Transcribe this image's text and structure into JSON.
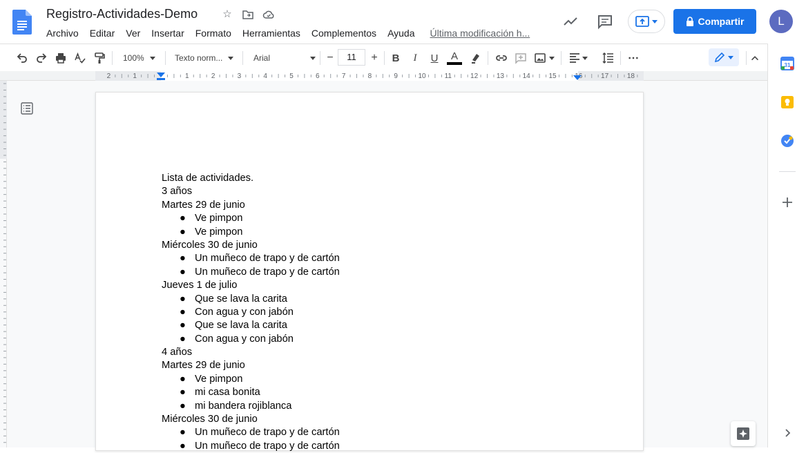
{
  "header": {
    "title": "Registro-Actividades-Demo",
    "menu": [
      "Archivo",
      "Editar",
      "Ver",
      "Insertar",
      "Formato",
      "Herramientas",
      "Complementos",
      "Ayuda"
    ],
    "last_edit": "Última modificación h...",
    "share_label": "Compartir",
    "avatar_letter": "L"
  },
  "toolbar": {
    "zoom": "100%",
    "style": "Texto norm...",
    "font": "Arial",
    "font_size": "11",
    "minus": "−",
    "plus": "+",
    "bold": "B",
    "italic": "I",
    "underline": "U",
    "text_color": "A",
    "more": "⋯"
  },
  "ruler_labels": [
    "2",
    "1",
    "1",
    "2",
    "3",
    "4",
    "5",
    "6",
    "7",
    "8",
    "9",
    "10",
    "11",
    "12",
    "13",
    "14",
    "15",
    "16",
    "17",
    "18"
  ],
  "document": {
    "lines": [
      {
        "type": "text",
        "text": "Lista de actividades."
      },
      {
        "type": "text",
        "text": "3 años"
      },
      {
        "type": "text",
        "text": "Martes 29 de junio"
      },
      {
        "type": "bullet",
        "text": "Ve pimpon"
      },
      {
        "type": "bullet",
        "text": "Ve pimpon"
      },
      {
        "type": "text",
        "text": "Miércoles 30 de junio"
      },
      {
        "type": "bullet",
        "text": "Un muñeco de trapo y de cartón"
      },
      {
        "type": "bullet",
        "text": "Un muñeco de trapo y de cartón"
      },
      {
        "type": "text",
        "text": "Jueves 1 de julio"
      },
      {
        "type": "bullet",
        "text": "Que se lava la carita"
      },
      {
        "type": "bullet",
        "text": "Con agua y con jabón"
      },
      {
        "type": "bullet",
        "text": "Que se lava la carita"
      },
      {
        "type": "bullet",
        "text": "Con agua y con jabón"
      },
      {
        "type": "text",
        "text": "4 años"
      },
      {
        "type": "text",
        "text": "Martes 29 de junio"
      },
      {
        "type": "bullet",
        "text": "Ve pimpon"
      },
      {
        "type": "bullet",
        "text": "mi casa bonita"
      },
      {
        "type": "bullet",
        "text": "mi bandera rojiblanca"
      },
      {
        "type": "text",
        "text": "Miércoles 30 de junio"
      },
      {
        "type": "bullet",
        "text": "Un muñeco de trapo y de cartón"
      },
      {
        "type": "bullet",
        "text": "Un muñeco de trapo y de cartón"
      }
    ],
    "bullet_glyph": "●"
  },
  "colors": {
    "accent": "#1a73e8",
    "avatar": "#5c6bc0",
    "docs_blue": "#4285f4"
  },
  "side_panel": {
    "calendar_day": "31"
  }
}
